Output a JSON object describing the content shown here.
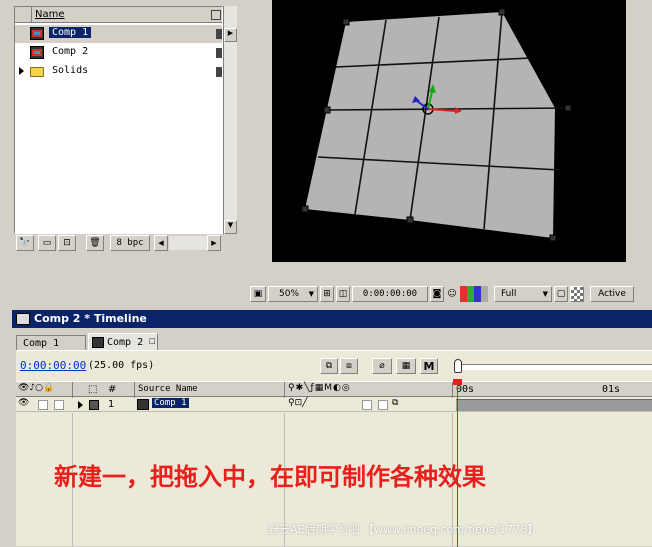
{
  "project": {
    "name_header": "Name",
    "items": [
      {
        "label": "Comp 1",
        "type": "composition",
        "selected": true
      },
      {
        "label": "Comp 2",
        "type": "composition",
        "selected": false
      },
      {
        "label": "Solids",
        "type": "folder",
        "selected": false
      }
    ],
    "bpc": "8 bpc"
  },
  "viewer": {
    "zoom": "50%",
    "timecode": "0:00:00:00",
    "resolution": "Full",
    "camera": "Active"
  },
  "timeline": {
    "title": "Comp 2 * Timeline",
    "tabs": [
      "Comp 1",
      "Comp 2"
    ],
    "current_time": "0:00:00:00",
    "fps": "(25.00 fps)",
    "col_number": "#",
    "col_source": "Source Name",
    "ruler_start": "00s",
    "ruler_mid": "01s",
    "mode_button": "M",
    "layers": [
      {
        "number": "1",
        "name": "Comp 1"
      }
    ]
  },
  "caption": "新建一，把拖入中，在即可制作各种效果",
  "watermark": "野云AE后期学习吧 【www.lineeg.com/tieba/1775】",
  "colors": {
    "title_bar": "#0a246a",
    "caption": "#e8201c",
    "selection": "#0a246a",
    "timeline_bg": "#ece9d8",
    "ruler_track": "#a6a6a6",
    "viewer_bg": "#000000",
    "layer_face": "#bdbdbd"
  }
}
